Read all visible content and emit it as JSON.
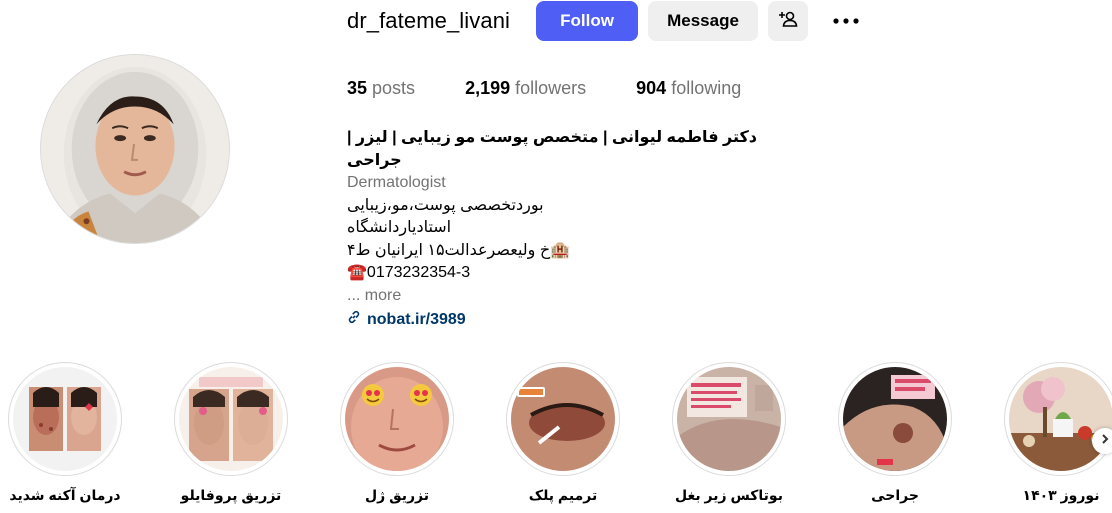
{
  "profile": {
    "username": "dr_fateme_livani",
    "follow_label": "Follow",
    "message_label": "Message",
    "icons": {
      "suggest": "person-add-icon",
      "more": "more-options-icon",
      "link": "link-icon"
    }
  },
  "stats": {
    "posts_count": "35",
    "posts_label": "posts",
    "followers_count": "2,199",
    "followers_label": "followers",
    "following_count": "904",
    "following_label": "following"
  },
  "bio": {
    "name": "دکتر فاطمه لیوانی | متخصص پوست مو زیبایی | لیزر |جراحی",
    "category": "Dermatologist",
    "line1": "بوردتخصصی پوست،مو،زیبایی",
    "line2": "استادیاردانشگاه",
    "line3": "🏨خ ولیعصرعدالت۱۵ ایرانیان ط۴",
    "line4": "☎️0173232354-3",
    "more": "... more",
    "link": "nobat.ir/3989"
  },
  "highlights": [
    {
      "label": "درمان آکنه شدید"
    },
    {
      "label": "تزریق پروفایلو"
    },
    {
      "label": "تزریق ژل"
    },
    {
      "label": "ترمیم پلک"
    },
    {
      "label": "بوتاکس زیر بغل"
    },
    {
      "label": "جراحی"
    },
    {
      "label": "نوروز ۱۴۰۳"
    }
  ],
  "colors": {
    "follow_button": "#4f5ef5",
    "secondary_button": "#efefef",
    "link": "#00376b",
    "muted": "#737373"
  }
}
